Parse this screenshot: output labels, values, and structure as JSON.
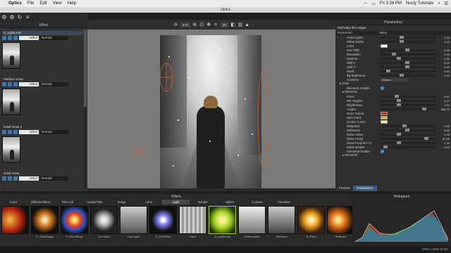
{
  "menubar": {
    "app_name": "Optics",
    "items": [
      "File",
      "Edit",
      "View",
      "Help"
    ],
    "clock": "Fri 3:26 PM",
    "user": "Nucly Tutorials"
  },
  "window": {
    "title": "Optics"
  },
  "canvas_toolbar": {
    "zoom": "9 %",
    "mode": "2K"
  },
  "effect_panel": {
    "title": "Effect",
    "layers": [
      {
        "name": "S_LightLeak",
        "opacity": "100.0",
        "blend": "Normal"
      },
      {
        "name": "medium snow",
        "opacity": "100.0",
        "blend": "Normal"
      },
      {
        "name": "small snow 2",
        "opacity": "100.0",
        "blend": "Normal"
      },
      {
        "name": "small snow",
        "opacity": "100.0",
        "blend": "Normal"
      }
    ]
  },
  "parameters": {
    "title": "Parameters",
    "preset": "Old leaky film edges",
    "col_param": "Parameter",
    "col_value": "Value",
    "rows": [
      {
        "name": "Scale Lights",
        "type": "slider",
        "value": "1.00",
        "level": 0.35
      },
      {
        "name": "Offset Darks",
        "type": "slider",
        "value": "1.00",
        "level": 0.35
      },
      {
        "name": "Color",
        "type": "color",
        "color": "#ffffff"
      },
      {
        "name": "Hue Shift",
        "type": "slider",
        "value": "0.00",
        "level": 0.45
      },
      {
        "name": "Saturation",
        "type": "slider",
        "value": "0.00",
        "level": 0.2
      },
      {
        "name": "Gamma",
        "type": "slider",
        "value": "1.00",
        "level": 0.3
      },
      {
        "name": "Shift X",
        "type": "slider",
        "value": "0.00",
        "level": 0.45
      },
      {
        "name": "Shift Y",
        "type": "slider",
        "value": "0.00",
        "level": 0.45
      },
      {
        "name": "Seed",
        "type": "slider",
        "value": "4.62",
        "level": 0.1
      },
      {
        "name": "Bg Brightness",
        "type": "slider",
        "value": "1.00",
        "level": 0.35
      },
      {
        "name": "Combine",
        "type": "dropdown",
        "value": "Screen"
      },
      {
        "name": "Glow",
        "type": "group"
      },
      {
        "name": "Element1 Enable",
        "type": "check",
        "value": "✓"
      },
      {
        "name": "Element1",
        "type": "subgroup"
      },
      {
        "name": "Size1",
        "type": "slider",
        "value": "0.87",
        "level": 0.25
      },
      {
        "name": "Rel Height1",
        "type": "slider",
        "value": "1.27",
        "level": 0.3
      },
      {
        "name": "Brightness1",
        "type": "slider",
        "value": "0.94",
        "level": 0.3
      },
      {
        "name": "Angle1",
        "type": "slider",
        "value": "265.70",
        "level": 0.75
      },
      {
        "name": "Outer Color1",
        "type": "color",
        "color": "#b83a1a"
      },
      {
        "name": "Mid Color1",
        "type": "color",
        "color": "#e8c020"
      },
      {
        "name": "Center Color1",
        "type": "color",
        "color": "#f2eeb0"
      },
      {
        "name": "Midpoint1",
        "type": "slider",
        "value": "0.50",
        "level": 0.4
      },
      {
        "name": "Softness1",
        "type": "slider",
        "value": "0.60",
        "level": 0.45
      },
      {
        "name": "Noise Amp1",
        "type": "slider",
        "value": "0.48",
        "level": 0.3
      },
      {
        "name": "Noise Freq1",
        "type": "slider",
        "value": "90.00",
        "level": 0.8
      },
      {
        "name": "Noise Freq Rel Y1",
        "type": "slider",
        "value": "1.00",
        "level": 0.3
      },
      {
        "name": "Noise Detail1",
        "type": "slider",
        "value": "0.00",
        "level": 0.05
      },
      {
        "name": "Element2 Enable",
        "type": "check",
        "value": "✓"
      },
      {
        "name": "Element2",
        "type": "subgroup"
      }
    ],
    "tabs": [
      "Presets",
      "Parameters"
    ]
  },
  "filters": {
    "title": "Filters",
    "categories": [
      "Color",
      "Diffusion/Blurs",
      "Film Lab",
      "Grads/Tints",
      "Image",
      "Lens",
      "Light",
      "Render",
      "Stylize",
      "Custom",
      "Favorites"
    ],
    "active_category": "Light",
    "thumbs": [
      {
        "label": "",
        "bg": "radial-gradient(circle at 30% 50%, #f4c040, #b02010 50%, #111 80%)"
      },
      {
        "label": "S_GlowEdges",
        "bg": "radial-gradient(ellipse at 50% 50%, #f0e0b0 10%, #d07020 35%, #111 70%)"
      },
      {
        "label": "S_GlowRings",
        "bg": "radial-gradient(circle at 50% 50%, #ffe070 10%, #e04020 35%, #3050c0 55%, #111 80%)"
      },
      {
        "label": "Ice Halos",
        "bg": "radial-gradient(circle at 50% 50%, #eeeeee 10%, #aaaaaa 30%, #222 60%)"
      },
      {
        "label": "Key Light",
        "bg": "linear-gradient(180deg,#ccc,#555)"
      },
      {
        "label": "S_LensFlare",
        "bg": "radial-gradient(circle at 50% 50%, #ffffff 8%, #8888ff 25%, #111 60%)"
      },
      {
        "label": "Light",
        "bg": "repeating-linear-gradient(90deg,#ccc 0 3px,#999 3px 6px)"
      },
      {
        "label": "S_LightLeak",
        "bg": "radial-gradient(ellipse at 50% 50%, #f8f090 15%, #a0d020 45%, #203010 80%)"
      },
      {
        "label": "Overexpose",
        "bg": "linear-gradient(180deg,#eee,#777)"
      },
      {
        "label": "Rainbow",
        "bg": "linear-gradient(180deg,#ccc,#444)"
      },
      {
        "label": "S_Rays",
        "bg": "radial-gradient(circle at 50% 50%, #fff4c0 10%, #f0a020 35%, #3a2010 70%)"
      },
      {
        "label": "Reflector",
        "bg": "radial-gradient(circle at 40% 50%, #ffe080 10%, #d06010 40%, #111 75%)"
      }
    ]
  },
  "histogram": {
    "title": "Histogram"
  },
  "status": {
    "dimensions": "4000 x 6000 (8 bit)"
  },
  "colors": {
    "accent": "#3b5a7a",
    "selected_filter_border": "#9ccd2c"
  }
}
